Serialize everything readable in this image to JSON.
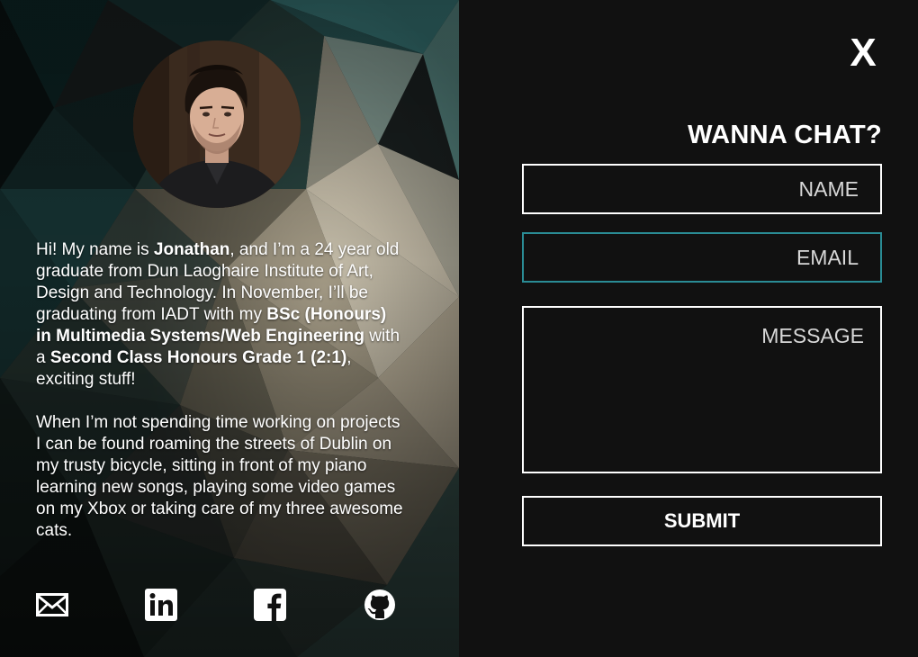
{
  "about": {
    "avatar_alt": "Jonathan",
    "bio_p1": [
      {
        "text": "Hi! My name is ",
        "bold": false
      },
      {
        "text": "Jonathan",
        "bold": true
      },
      {
        "text": ", and I’m a 24 year old graduate from Dun Laoghaire Institute of Art, Design and Technology. In November, I’ll be graduating from IADT with my ",
        "bold": false
      },
      {
        "text": "BSc (Honours) in Multimedia Systems/Web Engineering",
        "bold": true
      },
      {
        "text": " with a ",
        "bold": false
      },
      {
        "text": "Second Class Honours Grade 1 (2:1)",
        "bold": true
      },
      {
        "text": ", exciting stuff!",
        "bold": false
      }
    ],
    "bio_p2": "When I’m not spending time working on projects I can be found roaming the streets of Dublin on my trusty bicycle, sitting in front of my piano learning new songs, playing some video games on my Xbox or taking care of my three awesome cats.",
    "socials": [
      {
        "icon": "mail-icon"
      },
      {
        "icon": "linkedin-icon"
      },
      {
        "icon": "facebook-icon"
      },
      {
        "icon": "github-icon"
      }
    ]
  },
  "contact": {
    "close_label": "X",
    "title": "WANNA CHAT?",
    "name_placeholder": "NAME",
    "email_placeholder": "EMAIL",
    "message_placeholder": "MESSAGE",
    "submit_label": "SUBMIT",
    "email_focus_color": "#2a8c95"
  }
}
